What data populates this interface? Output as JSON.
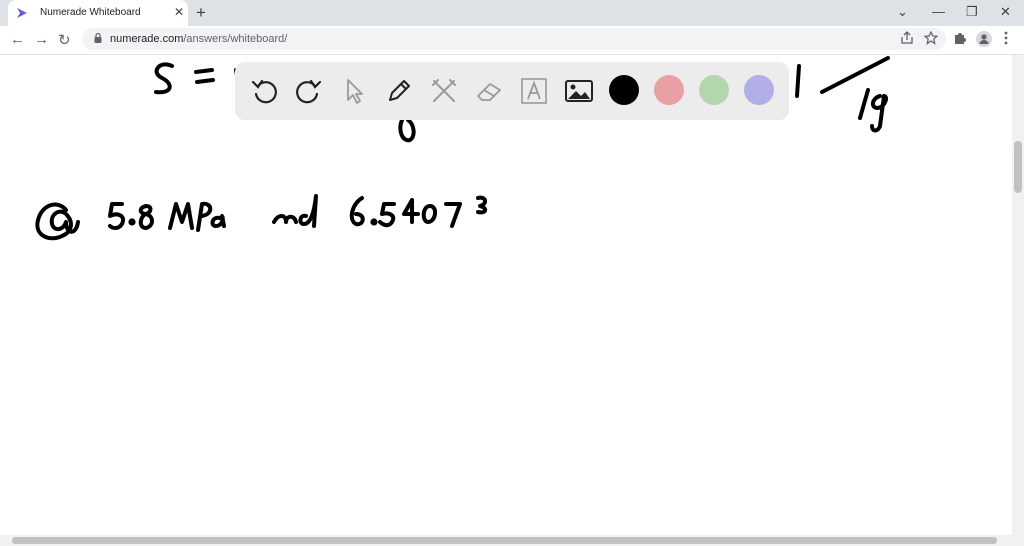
{
  "browser": {
    "tab_title": "Numerade Whiteboard",
    "tab_close": "✕",
    "new_tab": "+",
    "url_host": "numerade.com",
    "url_path": "/answers/whiteboard/",
    "window_controls": {
      "dropdown": "⌄",
      "minimize": "—",
      "restore": "❐",
      "close": "✕"
    }
  },
  "nav": {
    "back": "←",
    "forward": "→",
    "reload": "↻"
  },
  "toolbar_icons": [
    "share-icon",
    "star-icon",
    "extensions-icon",
    "profile-icon",
    "menu-icon"
  ],
  "whiteboard": {
    "tools": [
      "undo-icon",
      "redo-icon",
      "pointer-icon",
      "pen-icon",
      "tools-icon",
      "eraser-icon",
      "text-icon",
      "image-icon"
    ],
    "colors": [
      "#000000",
      "#e8a0a4",
      "#b2d6ad",
      "#b2aee8"
    ],
    "handwriting": {
      "line1": "S = …",
      "line1_unit": "kg",
      "line2": "@ 5.8 MPa and 6.5407"
    }
  }
}
